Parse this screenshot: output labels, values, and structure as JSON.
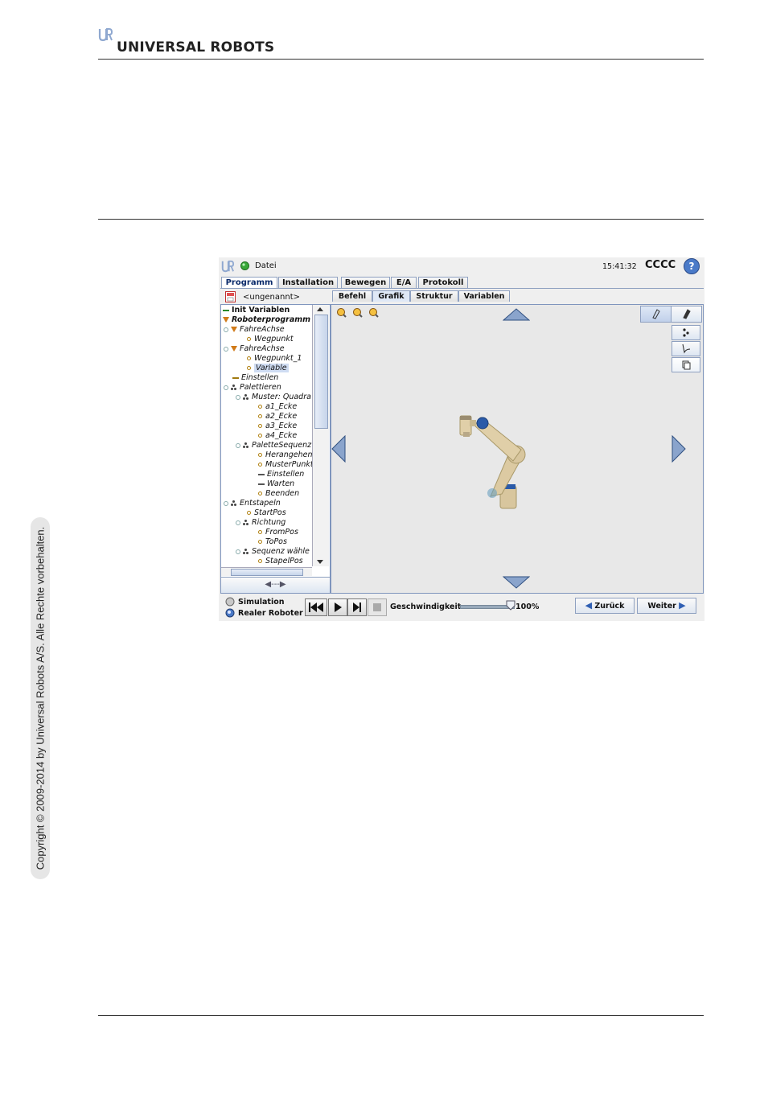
{
  "doc": {
    "brand": "UNIVERSAL ROBOTS",
    "copyright": "Copyright © 2009-2014 by Universal Robots A/S. Alle Rechte vorbehalten."
  },
  "ui": {
    "menu_label": "Datei",
    "clock": "15:41:32",
    "status_code": "CCCC",
    "help_symbol": "?",
    "tabs": [
      "Programm",
      "Installation",
      "Bewegen",
      "E/A",
      "Protokoll"
    ],
    "program_name": "<ungenannt>",
    "subtabs": [
      "Befehl",
      "Grafik",
      "Struktur",
      "Variablen"
    ],
    "tree": [
      {
        "label": "Init Variablen"
      },
      {
        "label": "Roboterprogramm"
      },
      {
        "label": "FahreAchse"
      },
      {
        "label": "Wegpunkt"
      },
      {
        "label": "FahreAchse"
      },
      {
        "label": "Wegpunkt_1"
      },
      {
        "label": "Variable"
      },
      {
        "label": "Einstellen"
      },
      {
        "label": "Palettieren"
      },
      {
        "label": "Muster: Quadra"
      },
      {
        "label": "a1_Ecke"
      },
      {
        "label": "a2_Ecke"
      },
      {
        "label": "a3_Ecke"
      },
      {
        "label": "a4_Ecke"
      },
      {
        "label": "PaletteSequenz"
      },
      {
        "label": "Herangehen"
      },
      {
        "label": "MusterPunkt"
      },
      {
        "label": "Einstellen"
      },
      {
        "label": "Warten"
      },
      {
        "label": "Beenden"
      },
      {
        "label": "Entstapeln"
      },
      {
        "label": "StartPos"
      },
      {
        "label": "Richtung"
      },
      {
        "label": "FromPos"
      },
      {
        "label": "ToPos"
      },
      {
        "label": "Sequenz wähle"
      },
      {
        "label": "StapelPos"
      }
    ],
    "collapse_arrows": "◀---▶",
    "mode_simulation": "Simulation",
    "mode_real": "Realer Roboter",
    "speed_label": "Geschwindigkeit",
    "speed_value": "100%",
    "speed_fraction": 1.0,
    "back_label": "Zurück",
    "next_label": "Weiter",
    "colors": {
      "accent_blue": "#2f5fb3",
      "tab_border": "#8ea0c0",
      "robot_body": "#d9c7a0",
      "robot_joint": "#2a5aa8",
      "status_green": "#39a839"
    }
  }
}
